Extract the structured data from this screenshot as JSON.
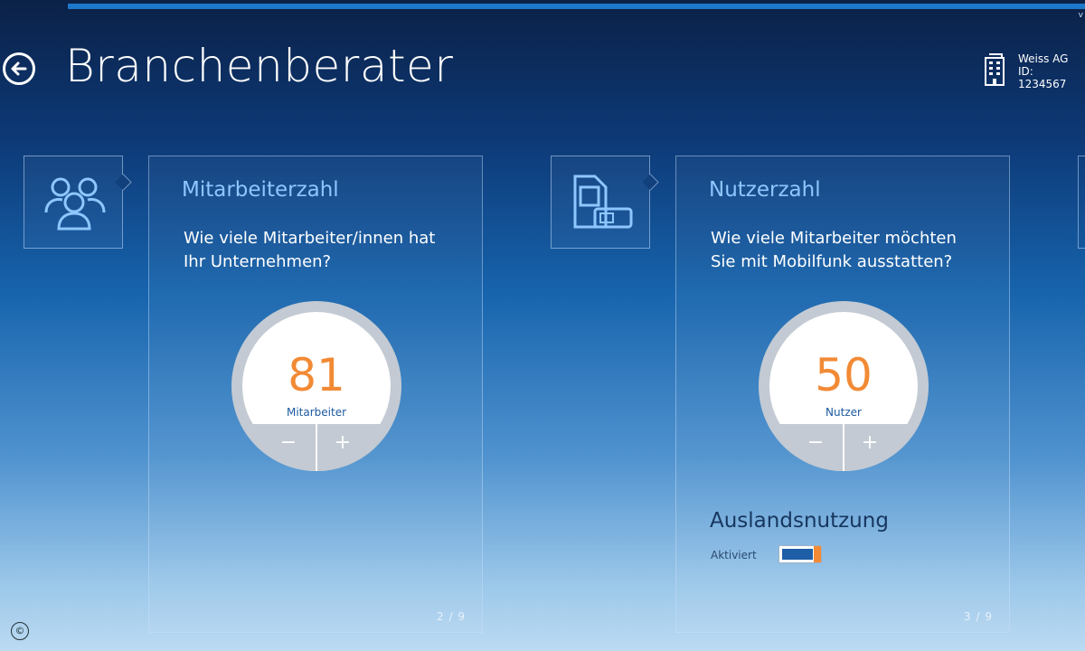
{
  "app": {
    "version": "v",
    "title": "Branchenberater"
  },
  "customer": {
    "name": "Weiss AG",
    "id": "ID: 1234567"
  },
  "cards": [
    {
      "title": "Mitarbeiterzahl",
      "question": "Wie viele Mitarbeiter/innen hat Ihr Unternehmen?",
      "value": "81",
      "unit": "Mitarbeiter",
      "minus": "−",
      "plus": "+",
      "pager": "2 / 9",
      "icon": "people-icon"
    },
    {
      "title": "Nutzerzahl",
      "question": "Wie viele Mitarbeiter möchten Sie mit Mobilfunk ausstatten?",
      "value": "50",
      "unit": "Nutzer",
      "minus": "−",
      "plus": "+",
      "pager": "3 / 9",
      "icon": "sim-card-icon",
      "toggle_section": {
        "title": "Auslandsnutzung",
        "label": "Aktiviert",
        "state": "on"
      }
    }
  ],
  "footer": {
    "copyright": "©"
  },
  "colors": {
    "accent": "#f28a35",
    "title_blue": "#8ec7ff",
    "dial_grey": "#c3cad3"
  }
}
